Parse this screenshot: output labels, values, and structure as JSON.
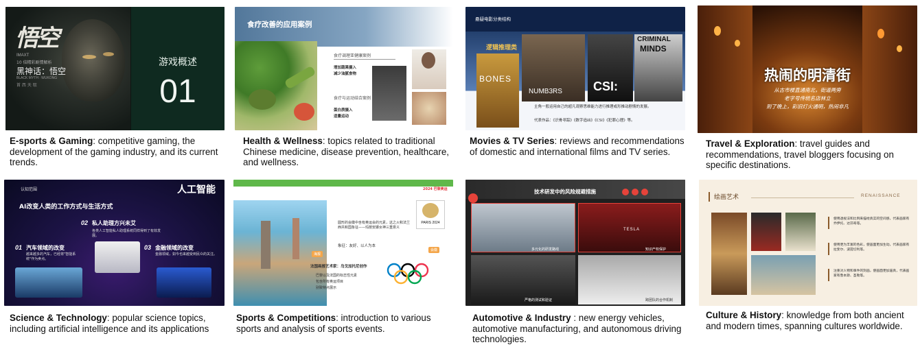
{
  "cards": [
    {
      "title": "E-sports & Gaming",
      "desc": ":  competitive gaming, the development of the gaming industry, and its current trends.",
      "slide": {
        "logo": "悟空",
        "meta1": "IMAXT",
        "meta2": "10 倍精彩剧情解析",
        "game_title": "黑神话：悟空",
        "meta3": "BLACK MYTH : WUKONG",
        "meta4": "首 西 天 取",
        "label": "游戏概述",
        "number": "01"
      }
    },
    {
      "title": "Health & Wellness",
      "desc": ": topics related to traditional Chinese medicine, disease prevention, healthcare, and wellness.",
      "slide": {
        "header": "食疗改善的应用案例",
        "case1": "食疗调理亚健康案例",
        "case1_items": [
          "增加蔬果摄入",
          "减少油腻食物"
        ],
        "case2": "食疗与运动结合案例",
        "case2_items": [
          "蛋白质摄入",
          "适量运动"
        ]
      }
    },
    {
      "title": "Movies & TV Series",
      "desc": ":  reviews and recommendations of domestic and international films and TV series.",
      "slide": {
        "header": "悬疑电影分类结构",
        "category": "逻辑推理类",
        "poster1": "BONES",
        "poster2": "NUMB3RS",
        "poster3": "CSI:",
        "poster4_line1": "CRIMINAL",
        "poster4_line2": "MINDS",
        "bullet1": "主角一般运用自己的超凡观察思维能力进行推理或形推动剧情的发展。",
        "bullet2": "代表作品：《识骨寻踪》《数字追凶》《CSI》《犯罪心理》等。"
      }
    },
    {
      "title": "Travel & Exploration",
      "desc": ": travel guides and recommendations, travel bloggers focusing on specific destinations.",
      "slide": {
        "headline": "热闹的明清街",
        "line1": "从古市楼直通南北，街道两旁",
        "line2": "老字号传统名店林立",
        "line3": "到了晚上，彩旧灯火通明，热闹非凡"
      }
    },
    {
      "title": "Science & Technology",
      "desc": ": popular science topics, including artificial intelligence and its applications",
      "slide": {
        "tag": "认知范围",
        "logo": "人工智能",
        "headline": "AI改变人类的工作方式与生活方式",
        "item2_num": "02",
        "item2_title": "私人助理方兴未艾",
        "item2_text": "各类人工智能私人助理系统同样得到了有效发展。",
        "item1_num": "01",
        "item1_title": "汽车领域的改变",
        "item1_text": "越来越多的汽车，已经将\"智能系统\"作为卖点。",
        "item3_num": "03",
        "item3_title": "金融领域的改变",
        "item3_text": "金融领域，如今也来越受到民众的关注。"
      }
    },
    {
      "title": "Sports & Competitions",
      "desc": ":  introduction to various sports and analysis of sports events.",
      "slide": {
        "badge": "2024 巴黎奥运",
        "emblem": "PARIS 2024",
        "text1": "圆形的会徽中含有奥运会的元素，这之火和法兰西共和国象征——玛丽安娜女神三重意义",
        "keywords": "象征：友好、以人为本",
        "art_title": "法国画报艺术家：乌戈加托尼创作",
        "art_items": [
          "巴黎以及法国的标志性元素",
          "包含所有奥运项目",
          "别致特点展示"
        ],
        "tag1": "海报",
        "tag2": "会徽"
      }
    },
    {
      "title": "Automotive & Industry",
      "desc": " : new energy vehicles, automotive manufacturing, and autonomous driving technologies.",
      "slide": {
        "header": "技术研发中的风险规避措施",
        "cap1": "多元化的研发路线",
        "cap2": "知识产权保护",
        "cap3": "严格的测试和验证",
        "cap4": "跨团队的合作机制",
        "brand": "TESLA"
      }
    },
    {
      "title": "Culture & History",
      "desc": ":  knowledge from both ancient and modern times, spanning cultures worldwide.",
      "slide": {
        "header": "绘画艺术",
        "header_en": "RENAISSANCE",
        "p1": "使用透视法和比例来描绘真实的空间感，代表画家有乔伊托、达芬奇等。",
        "p2": "使用更为丰富的色彩，使画面更加生动，代表画家有拉斐尔、波提切利等。",
        "p3": "注重对人物和事件的刻画，使画面更加逼真，代表画家有鲁本斯、圣勒等。"
      }
    }
  ]
}
